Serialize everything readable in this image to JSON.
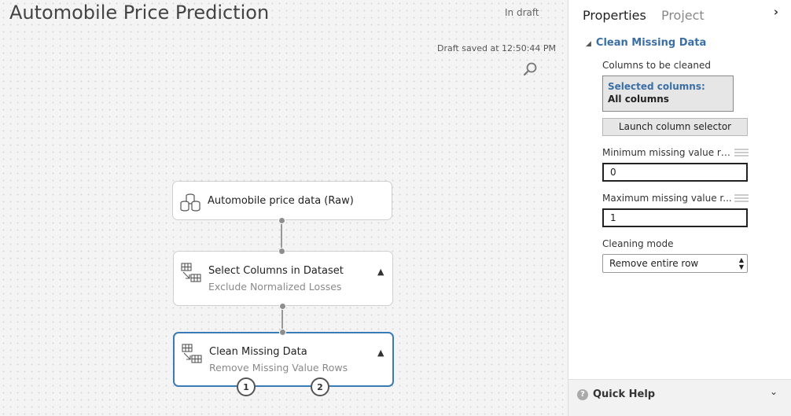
{
  "experiment": {
    "title": "Automobile Price Prediction",
    "status": "In draft",
    "saved_text": "Draft saved at 12:50:44 PM"
  },
  "modules": [
    {
      "name": "Automobile price data (Raw)",
      "subtitle": "",
      "icon": "dataset-icon"
    },
    {
      "name": "Select Columns in Dataset",
      "subtitle": "Exclude Normalized Losses",
      "icon": "module-icon"
    },
    {
      "name": "Clean Missing Data",
      "subtitle": "Remove Missing Value Rows",
      "icon": "module-icon",
      "ports": [
        "1",
        "2"
      ]
    }
  ],
  "panel": {
    "tabs": [
      "Properties",
      "Project"
    ],
    "section_title": "Clean Missing Data",
    "columns_label": "Columns to be cleaned",
    "selected_label": "Selected columns:",
    "selected_value": "All columns",
    "launch_button": "Launch column selector",
    "min_label": "Minimum missing value ra...",
    "min_value": "0",
    "max_label": "Maximum missing value r...",
    "max_value": "1",
    "mode_label": "Cleaning mode",
    "mode_value": "Remove entire row",
    "quick_help": "Quick Help"
  },
  "colors": {
    "accent": "#3a7bb5",
    "section_title": "#3a6fa6"
  }
}
